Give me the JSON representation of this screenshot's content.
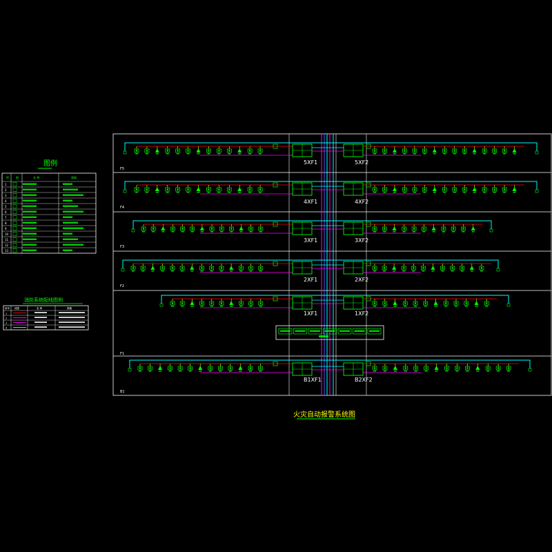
{
  "drawing": {
    "title": "火灾自动报警系统图",
    "legend_title": "图例",
    "wire_legend_title": "消防系统配线图例"
  },
  "floors": [
    {
      "label": "F5",
      "left_panel": "5XF1",
      "right_panel": "5XF2"
    },
    {
      "label": "F4",
      "left_panel": "4XF1",
      "right_panel": "4XF2"
    },
    {
      "label": "F3",
      "left_panel": "3XF1",
      "right_panel": "3XF2"
    },
    {
      "label": "F2",
      "left_panel": "2XF1",
      "right_panel": "2XF2"
    },
    {
      "label": "F1",
      "left_panel": "1XF1",
      "right_panel": "1XF2"
    },
    {
      "label": "B1",
      "left_panel": "B1XF1",
      "right_panel": "B2XF2"
    }
  ],
  "legend": {
    "headers": [
      "序",
      "图",
      "名 称",
      "规格"
    ],
    "rows": [
      "1",
      "2",
      "3",
      "4",
      "5",
      "6",
      "7",
      "8",
      "9",
      "10",
      "11",
      "12",
      "13"
    ]
  },
  "wire_legend": {
    "headers": [
      "序号",
      "线型",
      "名 称",
      "规格"
    ],
    "rows": [
      "1",
      "2",
      "3",
      "4"
    ]
  },
  "colors": {
    "background": "#000000",
    "frame": "#ffffff",
    "bus": "#00ffff",
    "green": "#00ff00",
    "red": "#ff0000",
    "magenta": "#ff00ff",
    "yellow": "#ffff00",
    "blue": "#4060ff"
  }
}
